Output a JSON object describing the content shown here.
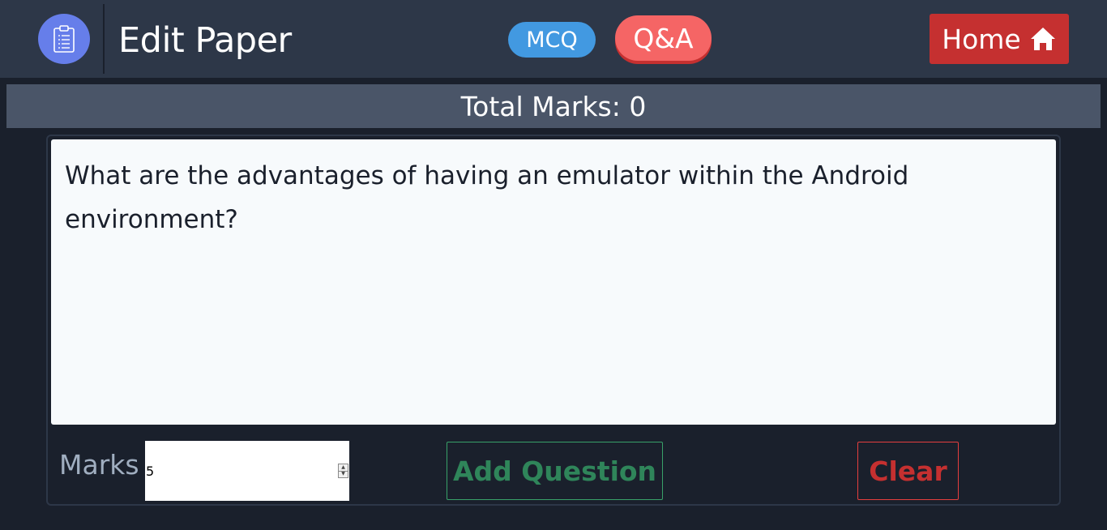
{
  "header": {
    "logo_icon": "clipboard-icon",
    "title": "Edit Paper",
    "mcq_label": "MCQ",
    "qa_label": "Q&A",
    "home_label": "Home",
    "home_icon": "home-icon",
    "colors": {
      "header_bg": "#2d3748",
      "logo_bg": "#667eea",
      "mcq_bg": "#4299e1",
      "qa_bg": "#f56565",
      "home_bg": "#c53030"
    }
  },
  "summary": {
    "total_marks": "Total Marks: 0"
  },
  "question": {
    "text": "What are the advantages of having an emulator within the Android environment?"
  },
  "controls": {
    "marks_label": "Marks",
    "marks_value": "5",
    "add_question_label": "Add Question",
    "clear_label": "Clear",
    "colors": {
      "add": "#2f855a",
      "clear": "#c53030"
    }
  }
}
